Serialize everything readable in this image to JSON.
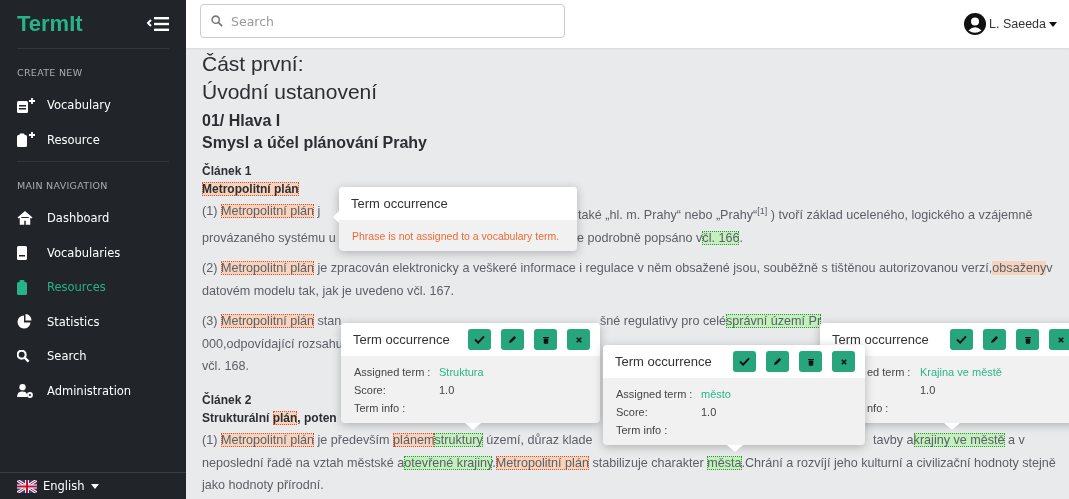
{
  "sidebar": {
    "logo": "TermIt",
    "sections": [
      {
        "heading": "CREATE NEW",
        "items": [
          {
            "label": "Vocabulary",
            "selected": false
          },
          {
            "label": "Resource",
            "selected": false
          }
        ]
      },
      {
        "heading": "MAIN NAVIGATION",
        "items": [
          {
            "label": "Dashboard",
            "selected": false
          },
          {
            "label": "Vocabularies",
            "selected": false
          },
          {
            "label": "Resources",
            "selected": true
          },
          {
            "label": "Statistics",
            "selected": false
          },
          {
            "label": "Search",
            "selected": false
          },
          {
            "label": "Administration",
            "selected": false
          }
        ]
      }
    ],
    "language": "English"
  },
  "topbar": {
    "search": {
      "placeholder": "Search"
    },
    "user": "L. Saeeda"
  },
  "document": [
    {
      "kind": "h1",
      "parts": [
        [
          {
            "text": "Část první:"
          }
        ]
      ]
    },
    {
      "kind": "h1",
      "parts": [
        [
          {
            "text": "Úvodní ustanovení"
          }
        ]
      ]
    },
    {
      "kind": "h2",
      "parts": [
        [
          {
            "text": "01/ Hlava I"
          }
        ]
      ]
    },
    {
      "kind": "h2",
      "parts": [
        [
          {
            "text": "Smysl a účel plánování Prahy"
          }
        ]
      ]
    },
    {
      "kind": "article",
      "parts": [
        [
          {
            "text": "Článek 1"
          }
        ]
      ]
    },
    {
      "kind": "article",
      "parts": [
        [
          {
            "text": "Metropolitní plán",
            "kind": "unassigned"
          }
        ]
      ]
    },
    {
      "kind": "para",
      "parts": [
        [
          {
            "text": "(1) "
          },
          {
            "text": "Metropolitní plán",
            "kind": "unassigned"
          },
          {
            "text": " j"
          }
        ],
        [
          {
            "text": "také „hl. m. Prahy“ nebo „Prahy“$^{[1]}$ ) tvoří základ uceleného, logického a vzájemně"
          }
        ]
      ]
    },
    {
      "kind": "text",
      "parts": [
        [
          {
            "text": "provázaného systému u"
          }
        ],
        [
          {
            "text": "e podrobně popsáno v"
          },
          {
            "text": "čl. 166",
            "kind": "assigned"
          },
          {
            "text": "."
          }
        ]
      ]
    },
    {
      "kind": "para",
      "parts": [
        [
          {
            "text": "(2) "
          },
          {
            "text": "Metropolitní plán",
            "kind": "unassigned"
          },
          {
            "text": " je zpracován elektronicky a veškeré informace i regulace v něm obsažené jsou, souběžně s tištěnou autorizovanou verzí,"
          },
          {
            "text": "obsaženy",
            "kind": "hovered"
          },
          {
            "text": "v"
          }
        ]
      ]
    },
    {
      "kind": "text",
      "parts": [
        [
          {
            "text": "datovém modelu tak, jak je uvedeno včl. 167."
          }
        ]
      ]
    },
    {
      "kind": "para",
      "parts": [
        [
          {
            "text": "(3) "
          },
          {
            "text": "Metropolitní plán",
            "kind": "unassigned"
          },
          {
            "text": " stan"
          }
        ],
        [
          {
            "text": "šné regulativy pro celé"
          },
          {
            "text": "správní území Pr",
            "kind": "assigned"
          }
        ]
      ]
    },
    {
      "kind": "text",
      "parts": [
        [
          {
            "text": "000,odpovídající rozsahu"
          }
        ]
      ]
    },
    {
      "kind": "text",
      "parts": [
        [
          {
            "text": "včl. 168."
          }
        ]
      ]
    },
    {
      "kind": "article",
      "parts": [
        [
          {
            "text": "Článek 2"
          }
        ]
      ]
    },
    {
      "kind": "article",
      "parts": [
        [
          {
            "text": "Strukturální "
          },
          {
            "text": "plán",
            "kind": "unassigned"
          },
          {
            "text": ", poten"
          }
        ]
      ]
    },
    {
      "kind": "para",
      "parts": [
        [
          {
            "text": "(1) "
          },
          {
            "text": "Metropolitní plán",
            "kind": "unassigned"
          },
          {
            "text": " je především "
          },
          {
            "text": "plánem",
            "kind": "unassigned"
          },
          {
            "text": "struktury",
            "kind": "assigned"
          },
          {
            "text": " území, důraz klade"
          }
        ],
        [
          {
            "text": "tavby a"
          },
          {
            "text": "krajiny ve městě",
            "kind": "assigned"
          },
          {
            "text": " a v"
          }
        ]
      ]
    },
    {
      "kind": "text",
      "parts": [
        [
          {
            "text": "neposlední řadě na vztah městské a"
          },
          {
            "text": "otevřené krajiny",
            "kind": "assigned"
          },
          {
            "text": "."
          },
          {
            "text": "Metropolitní plán",
            "kind": "unassigned"
          },
          {
            "text": " stabilizuje charakter "
          },
          {
            "text": "města",
            "kind": "assigned"
          },
          {
            "text": ".Chrání a rozvíjí jeho kulturní a civilizační hodnoty stejně"
          }
        ]
      ]
    },
    {
      "kind": "text",
      "parts": [
        [
          {
            "text": "jako hodnoty přírodní."
          }
        ]
      ]
    }
  ],
  "popovers": [
    {
      "kind": "message",
      "title": "Term occurrence",
      "message": "Phrase is not assigned to a vocabulary term."
    },
    {
      "kind": "assigned",
      "title": "Term occurrence",
      "fields": [
        {
          "label": "Assigned term :",
          "value": "Struktura",
          "link": true
        },
        {
          "label": "Score:",
          "value": "1.0",
          "link": false
        },
        {
          "label": "Term info :"
        }
      ]
    },
    {
      "kind": "assigned",
      "title": "Term occurrence",
      "fields": [
        {
          "label": "Assigned term :",
          "value": "město",
          "link": true
        },
        {
          "label": "Score:",
          "value": "1.0",
          "link": false
        },
        {
          "label": "Term info :"
        }
      ]
    },
    {
      "kind": "assigned",
      "title": "Term occurrence",
      "fields": [
        {
          "label": "ed term :",
          "value": "Krajina ve městě",
          "link": true
        },
        {
          "value": "1.0",
          "link": false
        },
        {
          "label": "nfo :"
        }
      ]
    }
  ]
}
